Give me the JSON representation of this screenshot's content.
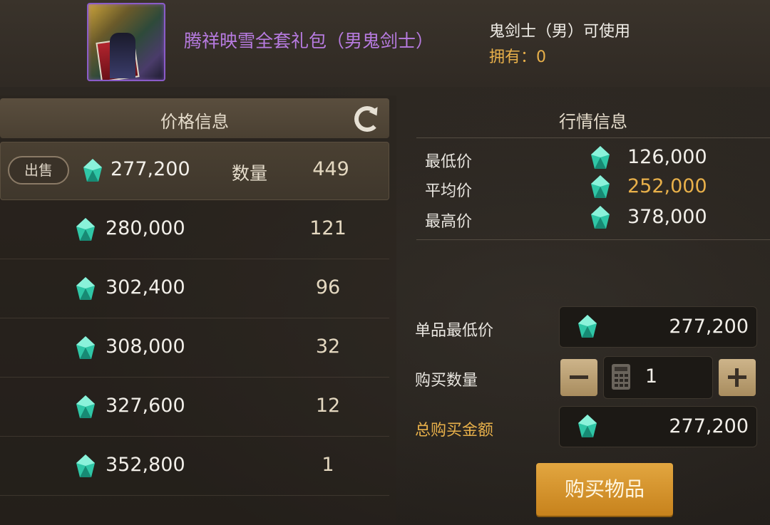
{
  "header": {
    "item_name": "腾祥映雪全套礼包（男鬼剑士）",
    "usable_by": "鬼剑士（男）可使用",
    "owned": "拥有：0"
  },
  "price_panel": {
    "title": "价格信息",
    "sell_label": "出售",
    "qty_label": "数量",
    "rows": [
      {
        "price": "277,200",
        "qty": "449"
      },
      {
        "price": "280,000",
        "qty": "121"
      },
      {
        "price": "302,400",
        "qty": "96"
      },
      {
        "price": "308,000",
        "qty": "32"
      },
      {
        "price": "327,600",
        "qty": "12"
      },
      {
        "price": "352,800",
        "qty": "1"
      }
    ]
  },
  "market_panel": {
    "title": "行情信息",
    "lowest_label": "最低价",
    "lowest_value": "126,000",
    "average_label": "平均价",
    "average_value": "252,000",
    "highest_label": "最高价",
    "highest_value": "378,000"
  },
  "purchase": {
    "unit_min_label": "单品最低价",
    "unit_min_value": "277,200",
    "quantity_label": "购买数量",
    "quantity_value": "1",
    "total_label": "总购买金额",
    "total_value": "277,200",
    "buy_button": "购买物品"
  },
  "colors": {
    "item_name": "#b77be0",
    "accent_gold": "#e8b04a",
    "buy_button": "#d8961e"
  },
  "icons": [
    "item-icon",
    "refresh-icon",
    "gem-icon",
    "calculator-icon",
    "minus-icon",
    "plus-icon"
  ]
}
